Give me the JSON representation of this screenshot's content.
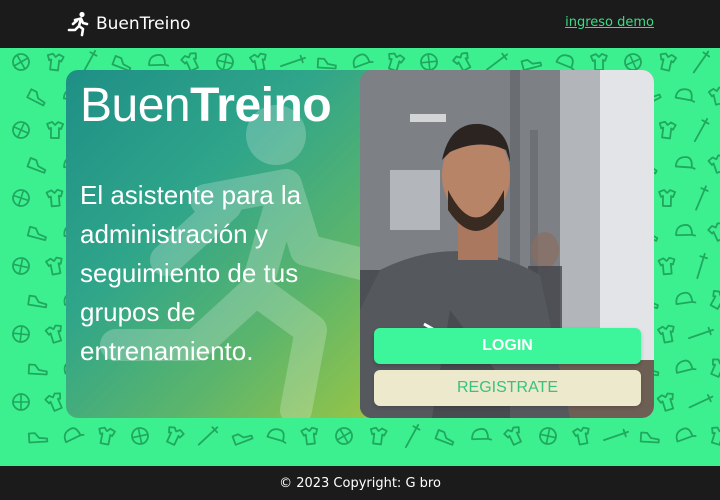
{
  "header": {
    "brand_name": "BuenTreino",
    "demo_link": "ingreso demo"
  },
  "hero": {
    "title_light": "Buen",
    "title_bold": "Treino",
    "subtitle": "El asistente para la administración y seguimiento de tus grupos de entrenamiento."
  },
  "actions": {
    "login_label": "LOGIN",
    "register_label": "REGISTRATE"
  },
  "footer": {
    "copyright": "© 2023 Copyright: G bro"
  },
  "colors": {
    "accent": "#3df59a",
    "pattern_bg": "#3df08f",
    "header_bg": "#1b1b1b",
    "register_bg": "#ece9cd"
  },
  "icons": {
    "brand": "running-person-icon",
    "pattern": "sports-doodle-icons"
  }
}
